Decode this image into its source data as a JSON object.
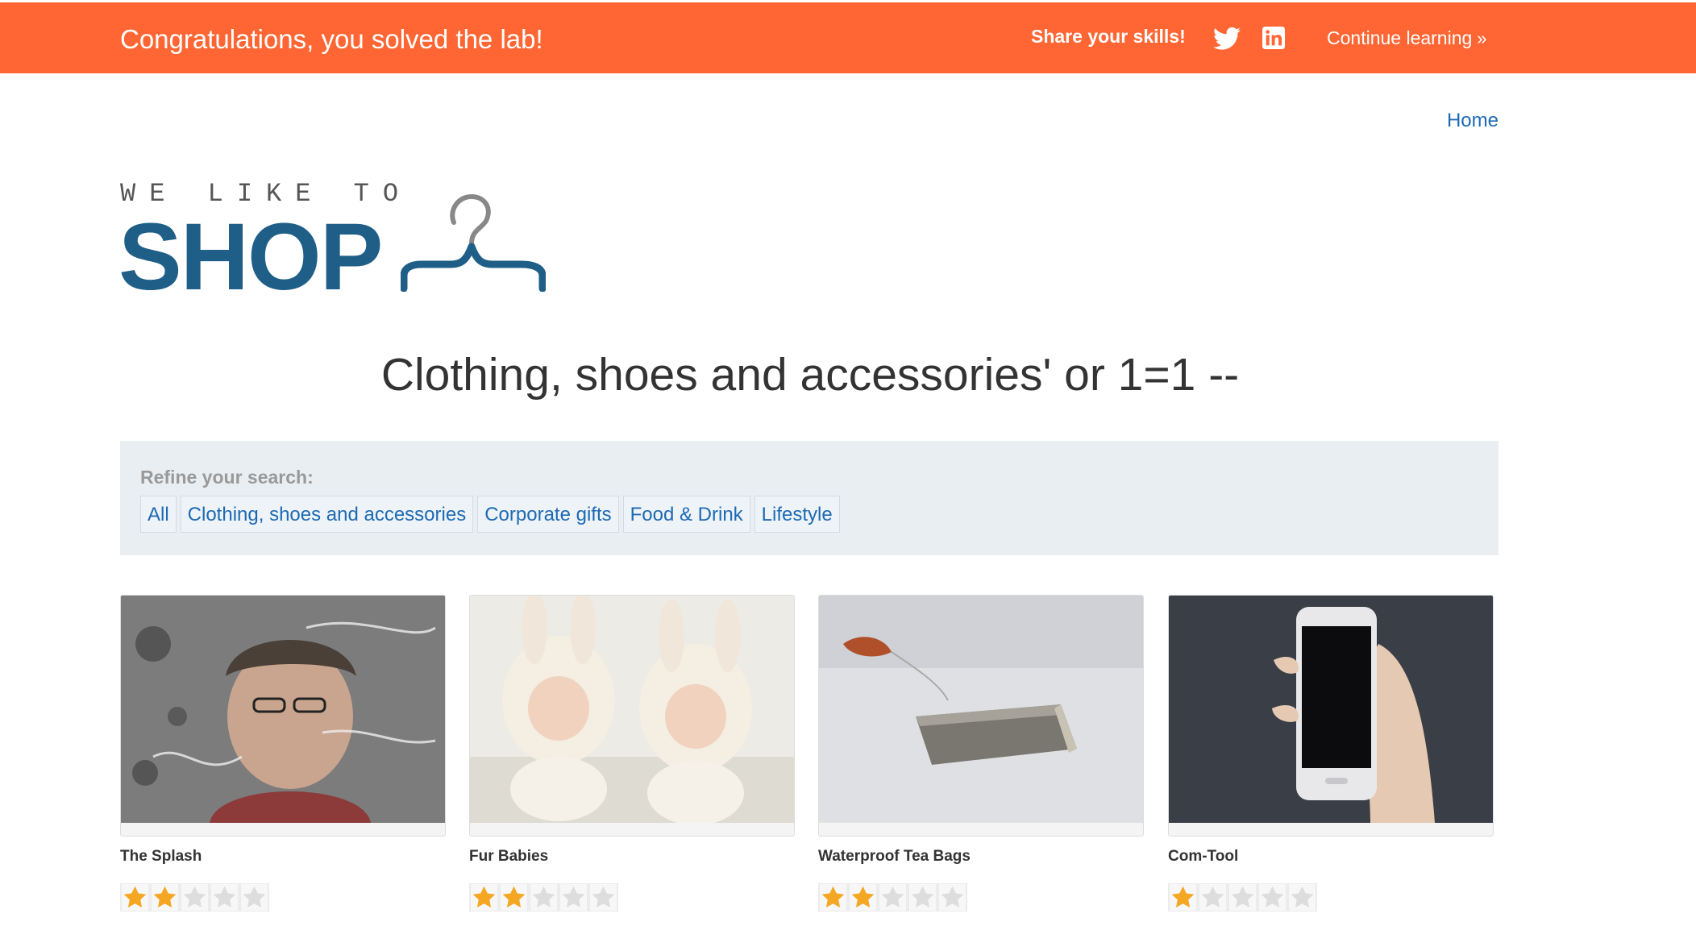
{
  "banner": {
    "title": "Congratulations, you solved the lab!",
    "share_label": "Share your skills!",
    "twitter_icon": "twitter-icon",
    "linkedin_icon": "linkedin-icon",
    "continue_label": "Continue learning",
    "continue_icon": "double-chevron-right-icon",
    "color": "#ff6633"
  },
  "nav": {
    "home_label": "Home"
  },
  "logo": {
    "top_text": "WE LIKE TO",
    "main_text": "SHOP",
    "icon": "hanger-icon",
    "color": "#1f5f87"
  },
  "heading": "Clothing, shoes and accessories' or 1=1 --",
  "filters": {
    "label": "Refine your search:",
    "links": [
      "All",
      "Clothing, shoes and accessories",
      "Corporate gifts",
      "Food & Drink",
      "Lifestyle"
    ]
  },
  "products": [
    {
      "name": "The Splash",
      "rating": 2,
      "image_icon": "splash-photo"
    },
    {
      "name": "Fur Babies",
      "rating": 2,
      "image_icon": "babies-photo"
    },
    {
      "name": "Waterproof Tea Bags",
      "rating": 2,
      "image_icon": "teabag-photo"
    },
    {
      "name": "Com-Tool",
      "rating": 1,
      "image_icon": "phone-photo"
    }
  ],
  "rating_max": 5,
  "colors": {
    "link": "#1d6ab3",
    "star_on": "#f5a623",
    "star_off": "#dddddd",
    "panel": "#e9eef2"
  }
}
